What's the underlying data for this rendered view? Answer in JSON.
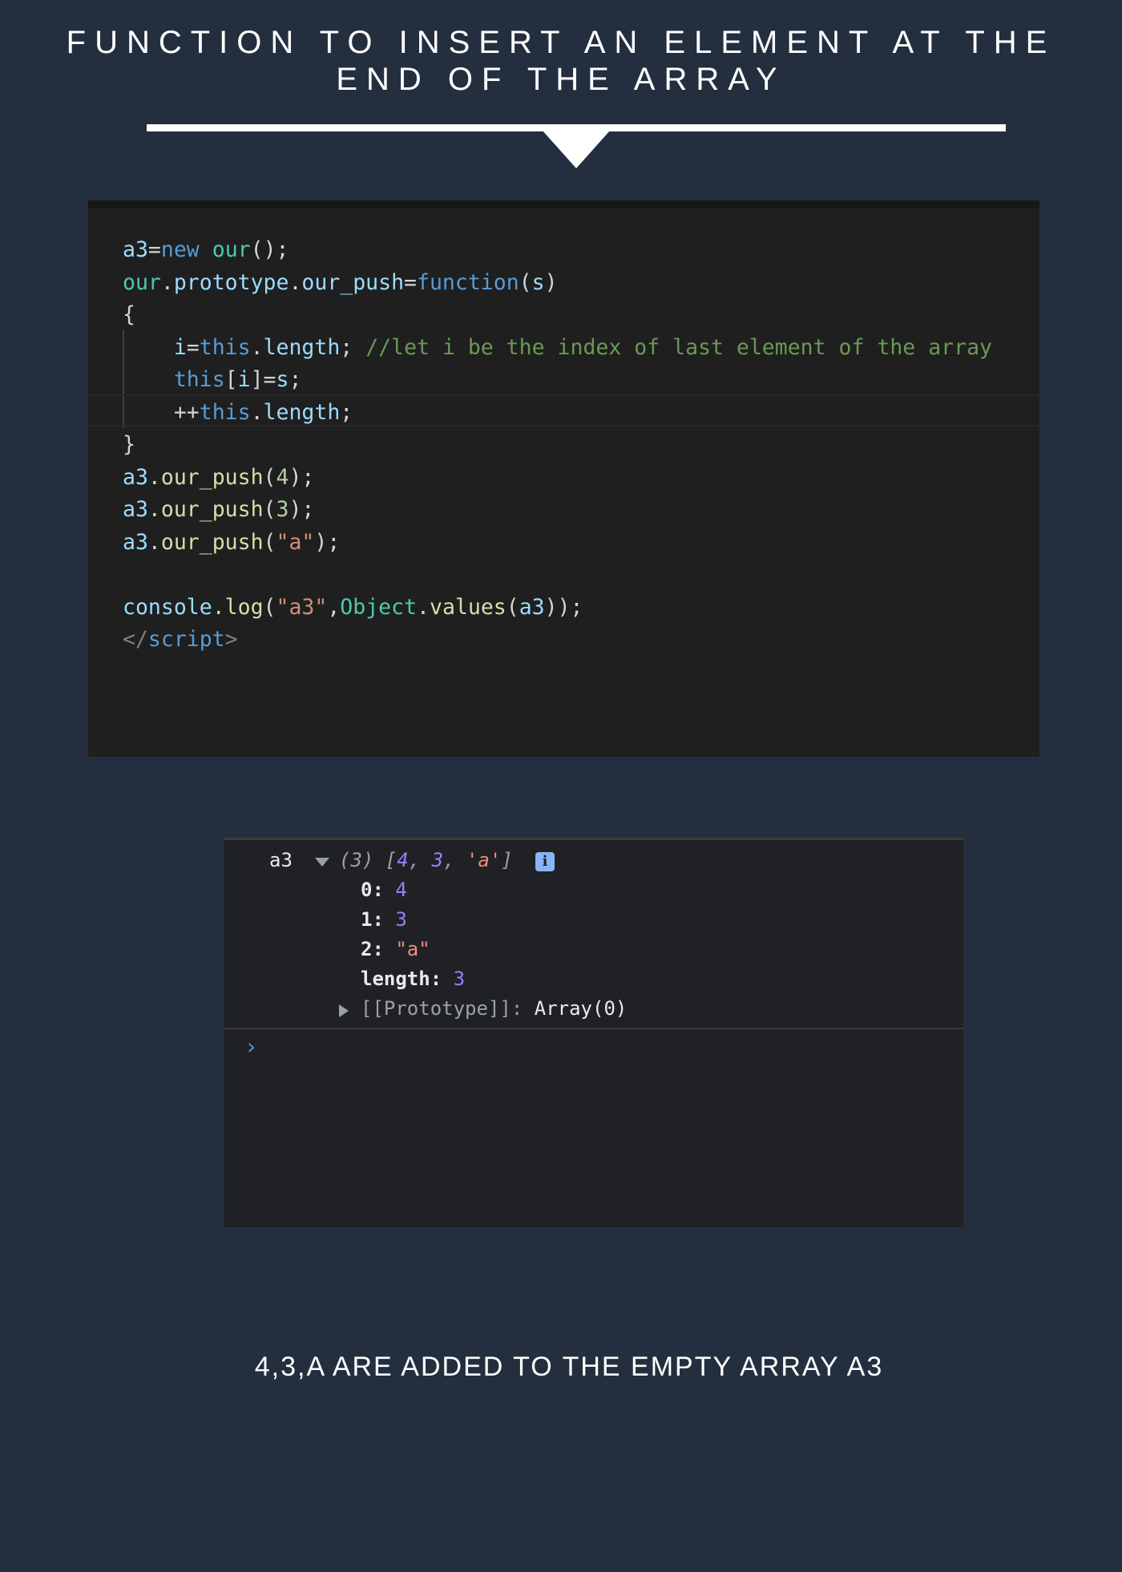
{
  "page": {
    "title": "FUNCTION TO INSERT AN ELEMENT AT THE END OF THE ARRAY",
    "caption": "4,3,A ARE ADDED TO THE EMPTY ARRAY A3"
  },
  "colors": {
    "background": "#232f3e",
    "editor_bg": "#1f1f1f",
    "console_bg": "#202124",
    "heading_text": "#ffffff"
  },
  "code": {
    "l1": {
      "a": "a3",
      "b": "=",
      "c": "new",
      "d": " ",
      "e": "our",
      "f": "();"
    },
    "l2": {
      "a": "our",
      "b": ".",
      "c": "prototype",
      "d": ".",
      "e": "our_push",
      "f": "=",
      "g": "function",
      "h": "(",
      "i": "s",
      "j": ")"
    },
    "l3": {
      "a": "{"
    },
    "l4": {
      "ind": "    ",
      "a": "i",
      "b": "=",
      "c": "this",
      "d": ".",
      "e": "length",
      "f": "; ",
      "g": "//let i be the index of last element of the array"
    },
    "l5": {
      "ind": "    ",
      "a": "this",
      "b": "[",
      "c": "i",
      "d": "]=",
      "e": "s",
      "f": ";"
    },
    "l6": {
      "ind": "    ",
      "a": "++",
      "b": "this",
      "c": ".",
      "d": "length",
      "e": ";"
    },
    "l7": {
      "a": "}"
    },
    "l8": {
      "a": "a3",
      "b": ".",
      "c": "our_push",
      "d": "(",
      "e": "4",
      "f": ");"
    },
    "l9": {
      "a": "a3",
      "b": ".",
      "c": "our_push",
      "d": "(",
      "e": "3",
      "f": ");"
    },
    "l10": {
      "a": "a3",
      "b": ".",
      "c": "our_push",
      "d": "(",
      "e": "\"a\"",
      "f": ");"
    },
    "l11": {
      "a": ""
    },
    "l12": {
      "a": "console",
      "b": ".",
      "c": "log",
      "d": "(",
      "e": "\"a3\"",
      "f": ",",
      "g": "Object",
      "h": ".",
      "i": "values",
      "j": "(",
      "k": "a3",
      "l": "));"
    },
    "l13": {
      "a": "</",
      "b": "script",
      "c": ">"
    }
  },
  "console": {
    "label": "a3",
    "summary": {
      "count": "(3) ",
      "open": "[",
      "v1": "4",
      "sep1": ", ",
      "v2": "3",
      "sep2": ", ",
      "v3": "'a'",
      "close": "]"
    },
    "info_badge": "i",
    "items": [
      {
        "key": "0",
        "colon": ": ",
        "value": "4"
      },
      {
        "key": "1",
        "colon": ": ",
        "value": "3"
      },
      {
        "key": "2",
        "colon": ": ",
        "value": "\"a\""
      },
      {
        "key": "length",
        "colon": ": ",
        "value": "3"
      }
    ],
    "prototype": {
      "key": "[[Prototype]]",
      "colon": ": ",
      "value": "Array(0)"
    },
    "prompt": "›"
  }
}
